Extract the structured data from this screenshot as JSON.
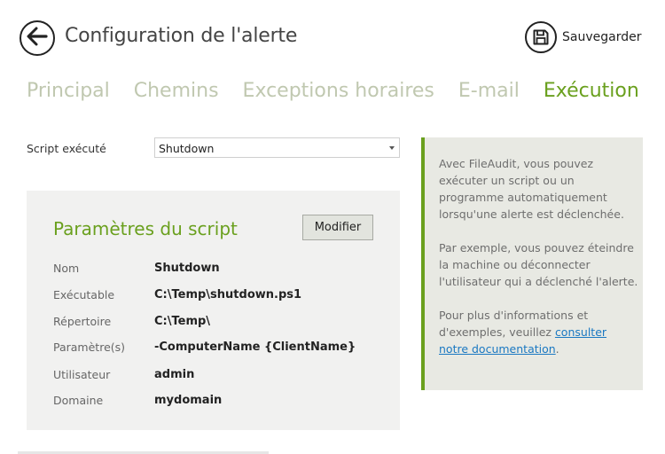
{
  "header": {
    "title": "Configuration de l'alerte",
    "save_label": "Sauvegarder"
  },
  "tabs": [
    {
      "label": "Principal",
      "active": false
    },
    {
      "label": "Chemins",
      "active": false
    },
    {
      "label": "Exceptions horaires",
      "active": false
    },
    {
      "label": "E-mail",
      "active": false
    },
    {
      "label": "Exécution",
      "active": true
    }
  ],
  "script": {
    "label": "Script exécuté",
    "selected": "Shutdown"
  },
  "params": {
    "title": "Paramètres du script",
    "modify_label": "Modifier",
    "rows": [
      {
        "label": "Nom",
        "value": "Shutdown"
      },
      {
        "label": "Exécutable",
        "value": "C:\\Temp\\shutdown.ps1"
      },
      {
        "label": "Répertoire",
        "value": "C:\\Temp\\"
      },
      {
        "label": "Paramètre(s)",
        "value": "-ComputerName {ClientName}"
      },
      {
        "label": "Utilisateur",
        "value": "admin"
      },
      {
        "label": "Domaine",
        "value": "mydomain"
      }
    ]
  },
  "info": {
    "p1": "Avec FileAudit, vous pouvez exécuter un script ou un programme automatiquement lorsqu'une alerte est déclenchée.",
    "p2": "Par exemple, vous pouvez éteindre la machine ou déconnecter l'utilisateur qui a déclenché l'alerte.",
    "p3_prefix": "Pour plus d'informations et d'exemples, veuillez ",
    "p3_link": "consulter notre documentation",
    "p3_suffix": "."
  },
  "colors": {
    "accent": "#6aa01e",
    "tab_inactive": "#c0c8b0",
    "link": "#1a78c2"
  }
}
